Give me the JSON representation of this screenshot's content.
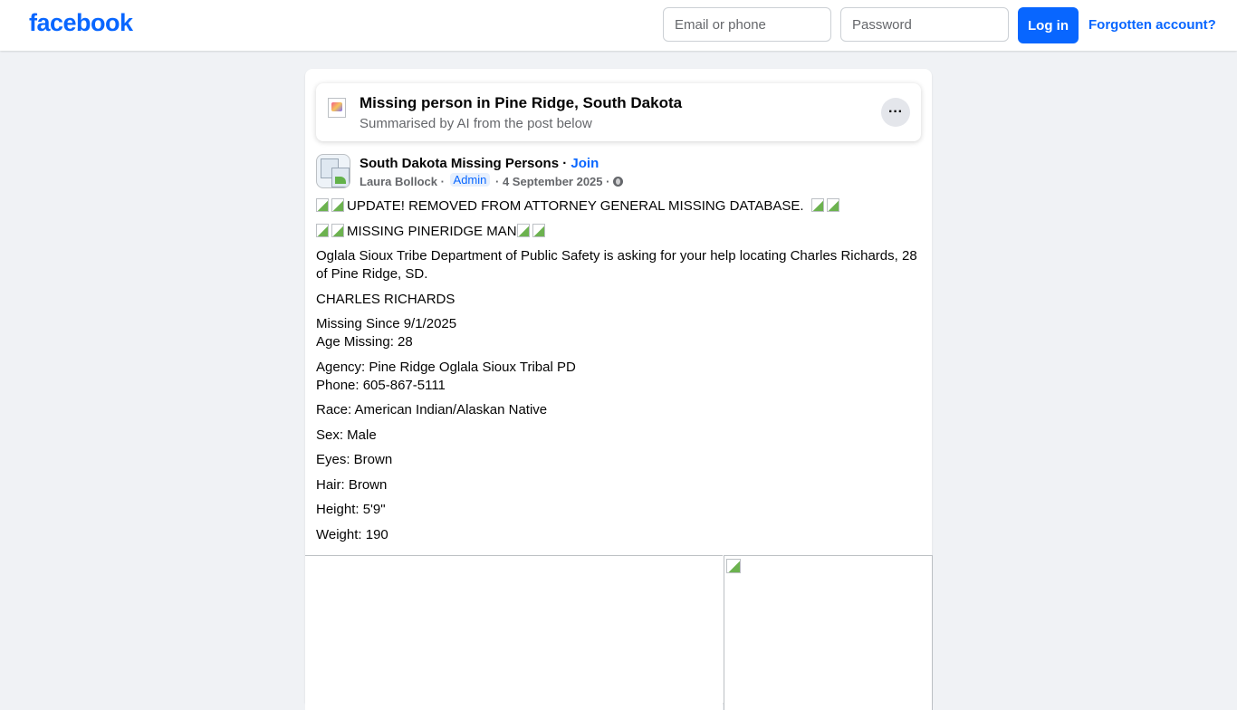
{
  "header": {
    "logo": "facebook",
    "email_placeholder": "Email or phone",
    "password_placeholder": "Password",
    "login_label": "Log in",
    "forgot_label": "Forgotten account?",
    "brand_color": "#0866ff"
  },
  "ai_summary": {
    "title": "Missing person in Pine Ridge, South Dakota",
    "subtitle": "Summarised by AI from the post below",
    "more_label": "···"
  },
  "post": {
    "group_name": "South Dakota Missing Persons",
    "join_separator": " · ",
    "join_label": "Join",
    "author": "Laura Bollock",
    "role_badge": "Admin",
    "date": "4 September 2025",
    "lines": {
      "update": "UPDATE!  REMOVED FROM ATTORNEY GENERAL MISSING DATABASE.",
      "missing": "MISSING PINERIDGE MAN",
      "intro": "Oglala Sioux Tribe Department of Public Safety   is asking for your help locating Charles Richards, 28 of Pine Ridge, SD.",
      "name": "CHARLES RICHARDS",
      "missing_since": "Missing Since 9/1/2025",
      "age": "Age Missing: 28",
      "agency": "Agency: Pine Ridge Oglala Sioux Tribal PD",
      "phone": "Phone: 605-867-5111",
      "race": "Race: American Indian/Alaskan Native",
      "sex": "Sex: Male",
      "eyes": "Eyes: Brown",
      "hair": "Hair: Brown",
      "height": "Height: 5'9\"",
      "weight": "Weight: 190"
    }
  }
}
